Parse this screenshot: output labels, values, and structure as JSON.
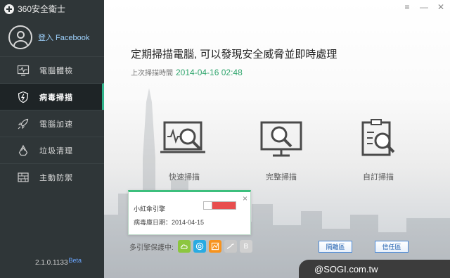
{
  "app": {
    "title": "360安全衛士"
  },
  "profile": {
    "login_label": "登入 Facebook"
  },
  "nav": [
    {
      "label": "電腦體檢",
      "icon": "monitor-pulse-icon"
    },
    {
      "label": "病毒掃描",
      "icon": "shield-bolt-icon",
      "active": true
    },
    {
      "label": "電腦加速",
      "icon": "rocket-icon"
    },
    {
      "label": "垃圾清理",
      "icon": "recycle-icon"
    },
    {
      "label": "主動防禦",
      "icon": "firewall-icon"
    }
  ],
  "version": {
    "number": "2.1.0.1133",
    "tag": "Beta"
  },
  "main": {
    "heading": "定期掃描電腦, 可以發現安全威脅並即時處理",
    "last_scan_label": "上次掃描時間",
    "last_scan_time": "2014-04-16 02:48",
    "options": [
      {
        "label": "快速掃描",
        "icon": "quick-scan-icon"
      },
      {
        "label": "完整掃描",
        "icon": "full-scan-icon"
      },
      {
        "label": "自訂掃描",
        "icon": "custom-scan-icon"
      }
    ]
  },
  "engine_popup": {
    "name": "小紅傘引擎",
    "date_label": "病毒庫日期：",
    "date": "2014-04-15",
    "close": "×"
  },
  "engines": {
    "label": "多引擎保護中:",
    "items": [
      {
        "icon": "cloud-engine-icon",
        "color": "#8cc63f"
      },
      {
        "icon": "qvm-engine-icon",
        "color": "#29abe2"
      },
      {
        "icon": "avira-engine-icon",
        "color": "#f7931e"
      },
      {
        "icon": "system-repair-icon",
        "color": "#c8c8c8"
      },
      {
        "icon": "bitdefender-engine-icon",
        "color": "#d0d0d0",
        "letter": "B"
      }
    ]
  },
  "buttons": {
    "quarantine": "隔離區",
    "trust": "信任區"
  },
  "watermark": "@SOGI.com.tw",
  "window_controls": {
    "menu": "≡",
    "minimize": "—",
    "close": "✕"
  },
  "colors": {
    "accent": "#2fa56d",
    "sidebar": "#2f3638",
    "link": "#9fd3ff"
  }
}
